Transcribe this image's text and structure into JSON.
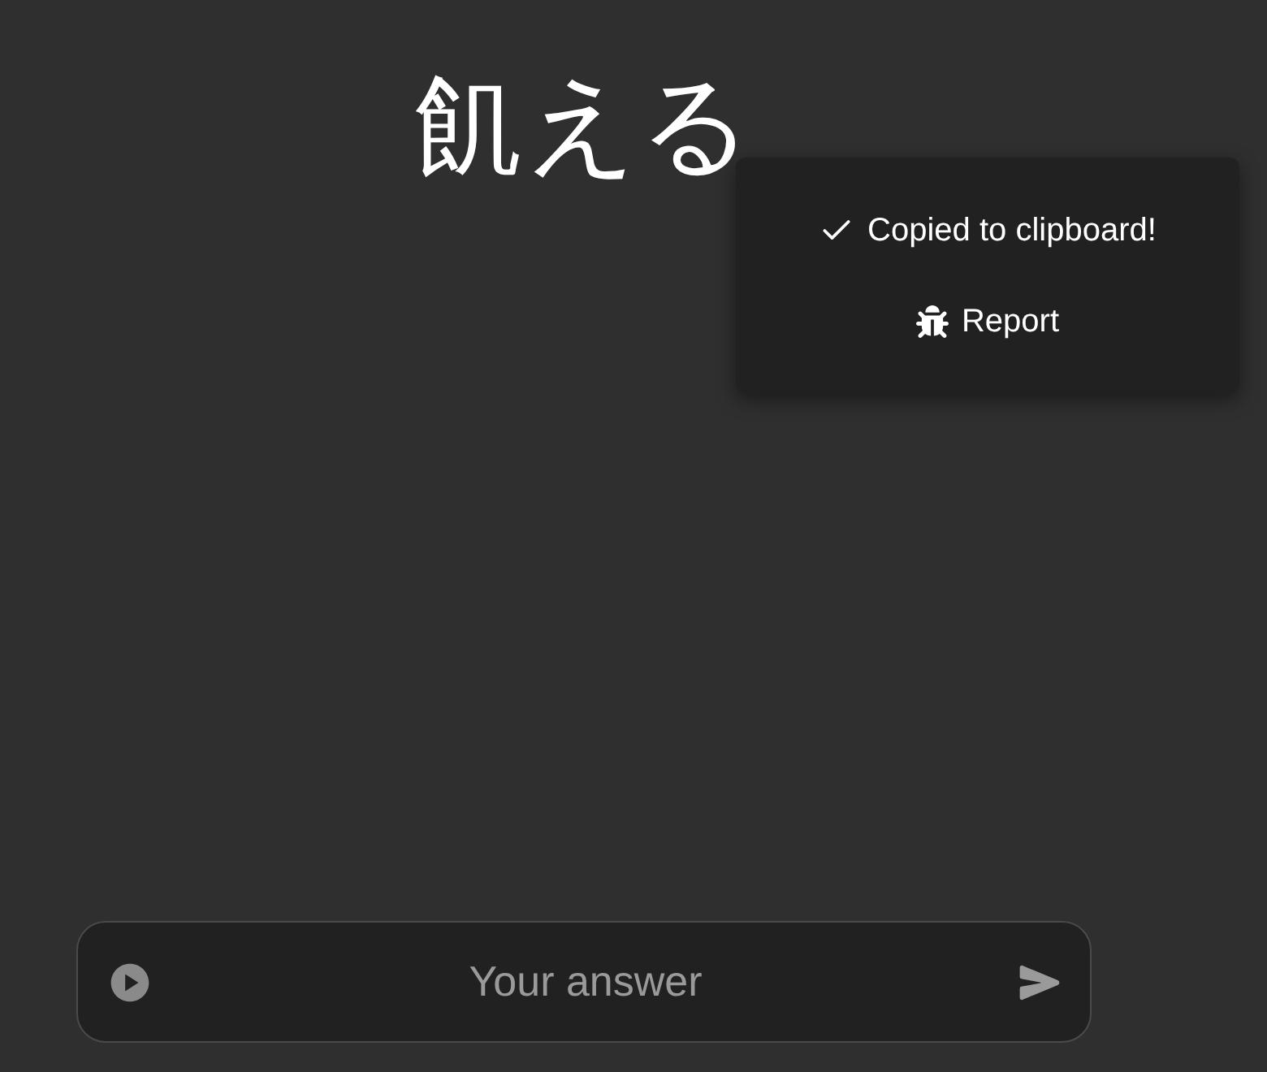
{
  "word": "飢える",
  "menu": [
    {
      "kind": "check",
      "label": "Copied to clipboard!"
    },
    {
      "kind": "bug",
      "label": "Report"
    }
  ],
  "answer": {
    "placeholder": "Your answer"
  }
}
